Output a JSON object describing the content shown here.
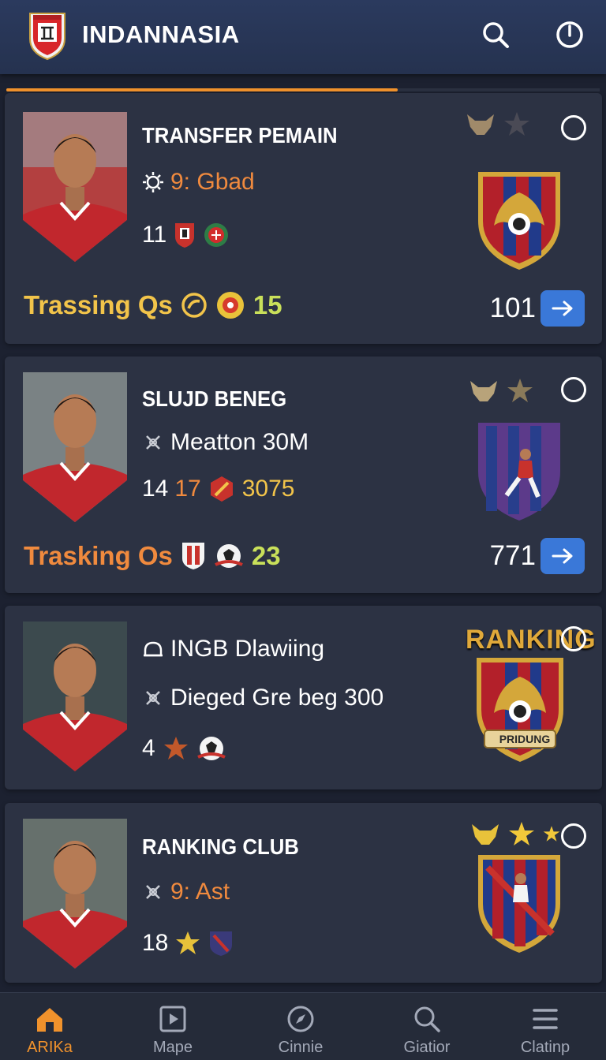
{
  "app": {
    "title": "INDANNASIA",
    "accent_color": "#f0922c",
    "header_icons": [
      "search-icon",
      "power-icon"
    ]
  },
  "progress": {
    "fraction": 0.66
  },
  "cards": [
    {
      "title": "TRANSFER PEMAIN",
      "line1": {
        "icon": "sun-icon",
        "text": "9: Gbad"
      },
      "line2": {
        "number": "11"
      },
      "footer_label": "Trassing Qs",
      "footer_value": "15",
      "right_number": "101"
    },
    {
      "title": "SLUJD BENEG",
      "line1": {
        "icon": "sparkle-icon",
        "text": "Meatton 30M"
      },
      "line2": {
        "number": "14",
        "number_b": "17",
        "number_c": "3075"
      },
      "footer_label": "Trasking Os",
      "footer_value": "23",
      "right_number": "771"
    },
    {
      "title": "INGB Dlawiing",
      "title_icon": "helmet-icon",
      "line1": {
        "icon": "sparkle-icon",
        "text": "Dieged Gre beg 300"
      },
      "line2": {
        "number": "4"
      },
      "crest_label": "RANKING",
      "crest_banner": "PRIDUNG"
    },
    {
      "title": "RANKING CLUB",
      "line1": {
        "icon": "sparkle-icon",
        "text": "9: Ast"
      },
      "line2": {
        "number": "18"
      }
    }
  ],
  "nav": [
    {
      "label": "ARIKa",
      "icon": "home-icon",
      "active": true
    },
    {
      "label": "Mape",
      "icon": "play-square-icon",
      "active": false
    },
    {
      "label": "Cinnie",
      "icon": "compass-icon",
      "active": false
    },
    {
      "label": "Giatior",
      "icon": "search-icon",
      "active": false
    },
    {
      "label": "Clatinp",
      "icon": "menu-icon",
      "active": false
    }
  ]
}
